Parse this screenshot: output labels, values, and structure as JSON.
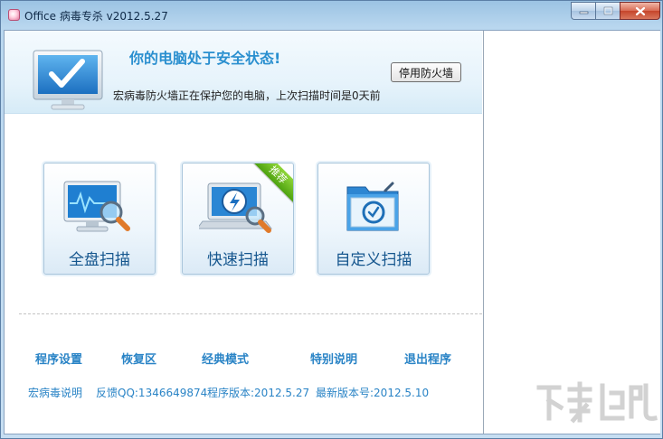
{
  "window": {
    "title": "Office 病毒专杀 v2012.5.27"
  },
  "status": {
    "title": "你的电脑处于安全状态!",
    "description": "宏病毒防火墙正在保护您的电脑，上次扫描时间是0天前",
    "firewall_button": "停用防火墙"
  },
  "scan_tiles": [
    {
      "label": "全盘扫描",
      "icon": "monitor-magnifier-icon"
    },
    {
      "label": "快速扫描",
      "icon": "laptop-lightning-icon",
      "badge": "推荐"
    },
    {
      "label": "自定义扫描",
      "icon": "folder-scan-icon"
    }
  ],
  "nav": [
    {
      "label": "程序设置"
    },
    {
      "label": "恢复区"
    },
    {
      "label": "经典模式"
    },
    {
      "label": "特别说明"
    },
    {
      "label": "退出程序"
    }
  ],
  "info": {
    "help": "宏病毒说明",
    "feedback": "反馈QQ:1346649874",
    "version": "程序版本:2012.5.27",
    "latest": "最新版本号:2012.5.10"
  },
  "colors": {
    "accent": "#2a8fcf",
    "link": "#2a84c6",
    "tile_text": "#15568e",
    "badge": "#5cae1a"
  }
}
